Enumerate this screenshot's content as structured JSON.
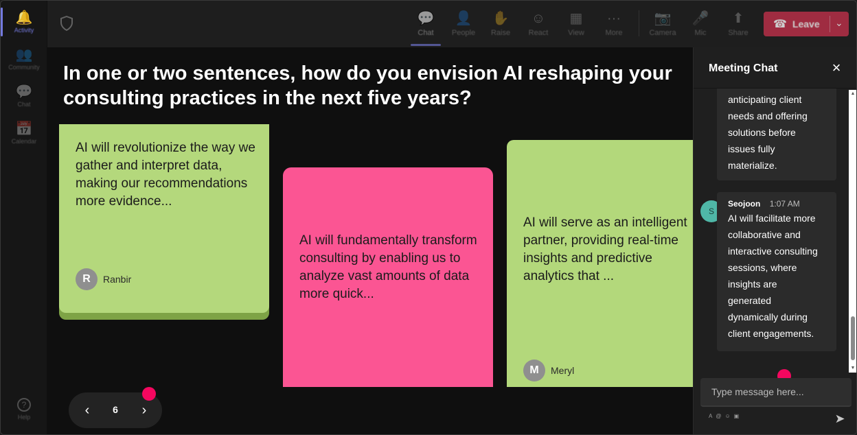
{
  "rail": {
    "items": [
      {
        "label": "Activity",
        "icon": "bell-icon",
        "glyph": "🔔"
      },
      {
        "label": "Community",
        "icon": "community-icon",
        "glyph": "👥"
      },
      {
        "label": "Chat",
        "icon": "chat-icon",
        "glyph": "💬"
      },
      {
        "label": "Calendar",
        "icon": "calendar-icon",
        "glyph": "📅"
      },
      {
        "label": "Help",
        "icon": "help-icon",
        "glyph": "?"
      }
    ]
  },
  "topbar": {
    "buttons": [
      {
        "label": "Chat",
        "glyph": "💬"
      },
      {
        "label": "People",
        "glyph": "👤"
      },
      {
        "label": "Raise",
        "glyph": "✋"
      },
      {
        "label": "React",
        "glyph": "☺"
      },
      {
        "label": "View",
        "glyph": "▦"
      },
      {
        "label": "More",
        "glyph": "···"
      },
      {
        "label": "Camera",
        "glyph": "📷"
      },
      {
        "label": "Mic",
        "glyph": "🎤"
      },
      {
        "label": "Share",
        "glyph": "⬆"
      }
    ],
    "leave_label": "Leave"
  },
  "stage": {
    "question": "In one or two sentences, how do you envision AI reshaping your consulting practices in the next five years?",
    "notes": [
      {
        "text": "AI will revolutionize the way we gather and interpret data, making our recommendations more evidence...",
        "author": "Ranbir",
        "initial": "R",
        "color": "#b4d87c"
      },
      {
        "text": "AI will fundamentally transform consulting by enabling us to analyze vast amounts of data more quick...",
        "color": "#fb5593"
      },
      {
        "text": "AI will serve as an intelligent partner, providing real-time insights and predictive analytics that ...",
        "author": "Meryl",
        "initial": "M",
        "color": "#b3d87b"
      }
    ],
    "page_number": "6",
    "accent_dot_color": "#f4075f"
  },
  "chat": {
    "title": "Meeting Chat",
    "messages": [
      {
        "text_lines": [
          "anticipating client",
          "needs and offering",
          "solutions before",
          "issues fully",
          "materialize."
        ]
      },
      {
        "sender": "Seojoon",
        "initial": "S",
        "time": "1:07 AM",
        "text_lines": [
          "AI will facilitate more",
          "collaborative and",
          "interactive consulting",
          "sessions, where",
          "insights are",
          "generated",
          "dynamically during",
          "client engagements."
        ]
      }
    ],
    "input_placeholder": "Type message here..."
  }
}
